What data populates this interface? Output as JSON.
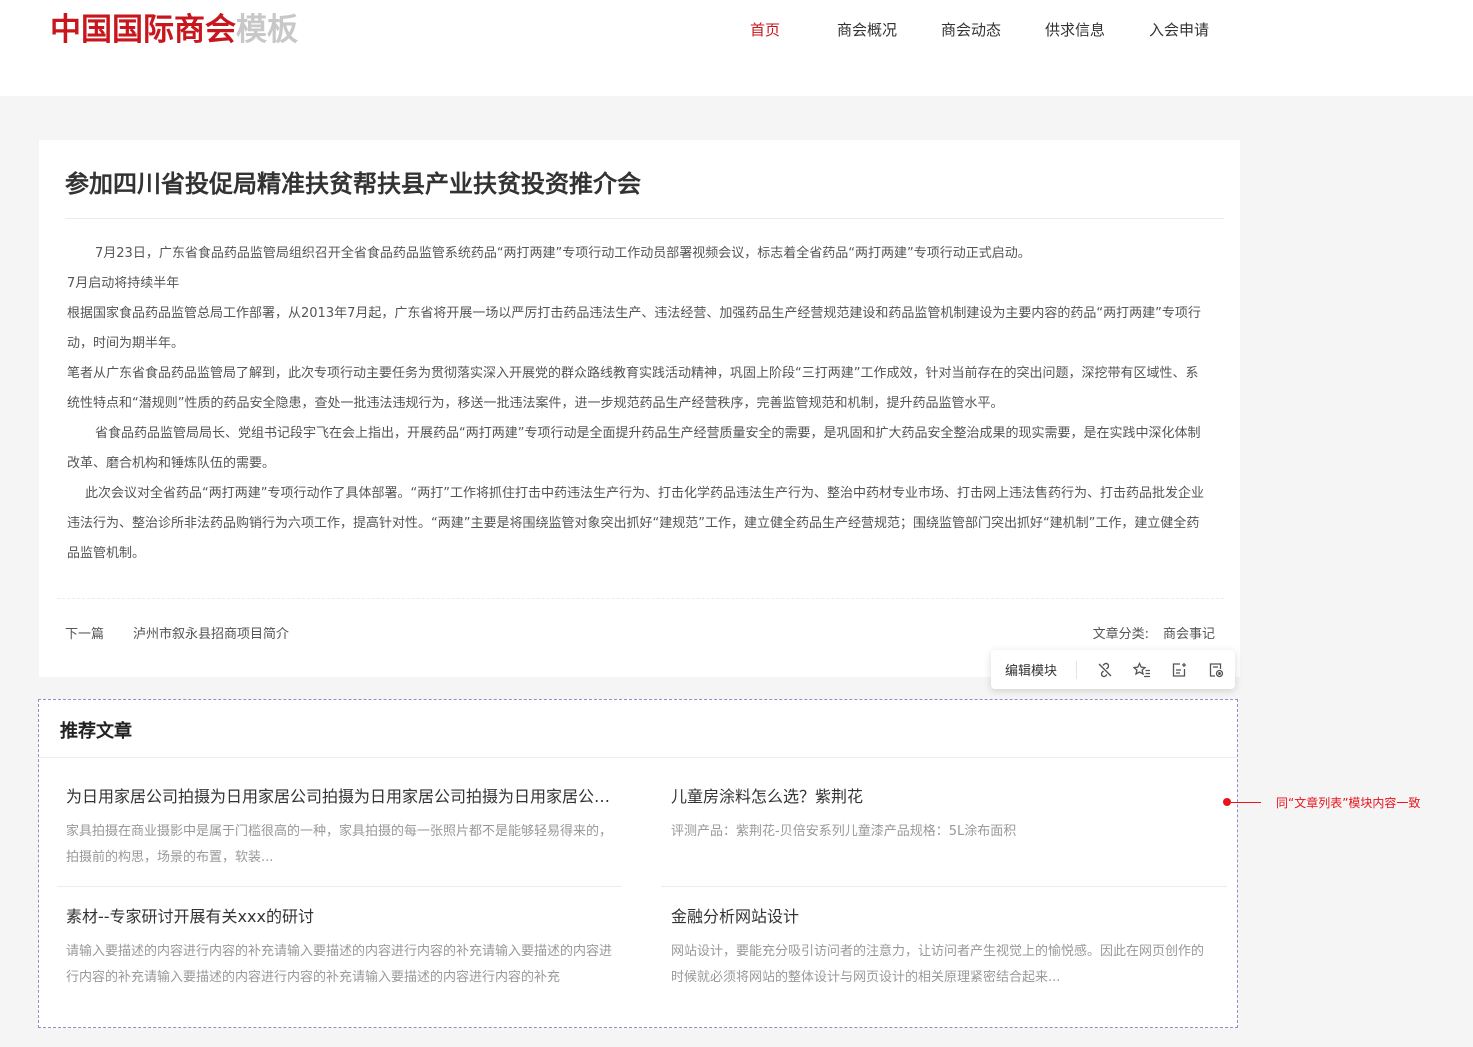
{
  "header": {
    "logo_main": "中国国际商会",
    "logo_sub": "模板",
    "nav": [
      {
        "label": "首页",
        "active": true
      },
      {
        "label": "商会概况",
        "active": false
      },
      {
        "label": "商会动态",
        "active": false
      },
      {
        "label": "供求信息",
        "active": false
      },
      {
        "label": "入会申请",
        "active": false
      }
    ]
  },
  "article": {
    "title": "参加四川省投促局精准扶贫帮扶县产业扶贫投资推介会",
    "paragraphs": [
      "7月23日，广东省食品药品监管局组织召开全省食品药品监管系统药品“两打两建”专项行动工作动员部署视频会议，标志着全省药品“两打两建”专项行动正式启动。",
      "7月启动将持续半年",
      "根据国家食品药品监管总局工作部署，从2013年7月起，广东省将开展一场以严厉打击药品违法生产、违法经营、加强药品生产经营规范建设和药品监管机制建设为主要内容的药品“两打两建”专项行动，时间为期半年。",
      "笔者从广东省食品药品监管局了解到，此次专项行动主要任务为贯彻落实深入开展党的群众路线教育实践活动精神，巩固上阶段“三打两建”工作成效，针对当前存在的突出问题，深挖带有区域性、系统性特点和“潜规则”性质的药品安全隐患，查处一批违法违规行为，移送一批违法案件，进一步规范药品生产经营秩序，完善监管规范和机制，提升药品监管水平。",
      "省食品药品监管局局长、党组书记段宇飞在会上指出，开展药品“两打两建”专项行动是全面提升药品生产经营质量安全的需要，是巩固和扩大药品安全整治成果的现实需要，是在实践中深化体制改革、磨合机构和锤炼队伍的需要。",
      "此次会议对全省药品“两打两建”专项行动作了具体部署。“两打”工作将抓住打击中药违法生产行为、打击化学药品违法生产行为、整治中药材专业市场、打击网上违法售药行为、打击药品批发企业违法行为、整治诊所非法药品购销行为六项工作，提高针对性。“两建”主要是将围绕监管对象突出抓好“建规范”工作，建立健全药品生产经营规范；围绕监管部门突出抓好“建机制”工作，建立健全药品监管机制。"
    ],
    "next_label": "下一篇",
    "next_title": "泸州市叙永县招商项目简介",
    "category_label": "文章分类:",
    "category_value": "商会事记"
  },
  "toolbar": {
    "edit_label": "编辑模块",
    "icons": [
      "unlink-icon",
      "star-list-icon",
      "add-note-icon",
      "page-settings-icon"
    ]
  },
  "recommend": {
    "title": "推荐文章",
    "items": [
      {
        "title": "为日用家居公司拍摄为日用家居公司拍摄为日用家居公司拍摄为日用家居公司拍摄",
        "desc": "家具拍摄在商业摄影中是属于门槛很高的一种，家具拍摄的每一张照片都不是能够轻易得来的，拍摄前的构思，场景的布置，软装..."
      },
      {
        "title": "儿童房涂料怎么选？紫荆花",
        "desc": "评测产品：紫荆花-贝倍安系列儿童漆产品规格：5L涂布面积"
      },
      {
        "title": "素材--专家研讨开展有关xxx的研讨",
        "desc": "请输入要描述的内容进行内容的补充请输入要描述的内容进行内容的补充请输入要描述的内容进行内容的补充请输入要描述的内容进行内容的补充请输入要描述的内容进行内容的补充"
      },
      {
        "title": "金融分析网站设计",
        "desc": "网站设计，要能充分吸引访问者的注意力，让访问者产生视觉上的愉悦感。因此在网页创作的时候就必须将网站的整体设计与网页设计的相关原理紧密结合起来..."
      }
    ]
  },
  "annotation": {
    "text": "同“文章列表”模块内容一致"
  },
  "colors": {
    "brand_red": "#c8161d",
    "logo_gray": "#c8c8c8",
    "annotation_red": "#e8131c",
    "dashed_border": "#8a93c2"
  }
}
